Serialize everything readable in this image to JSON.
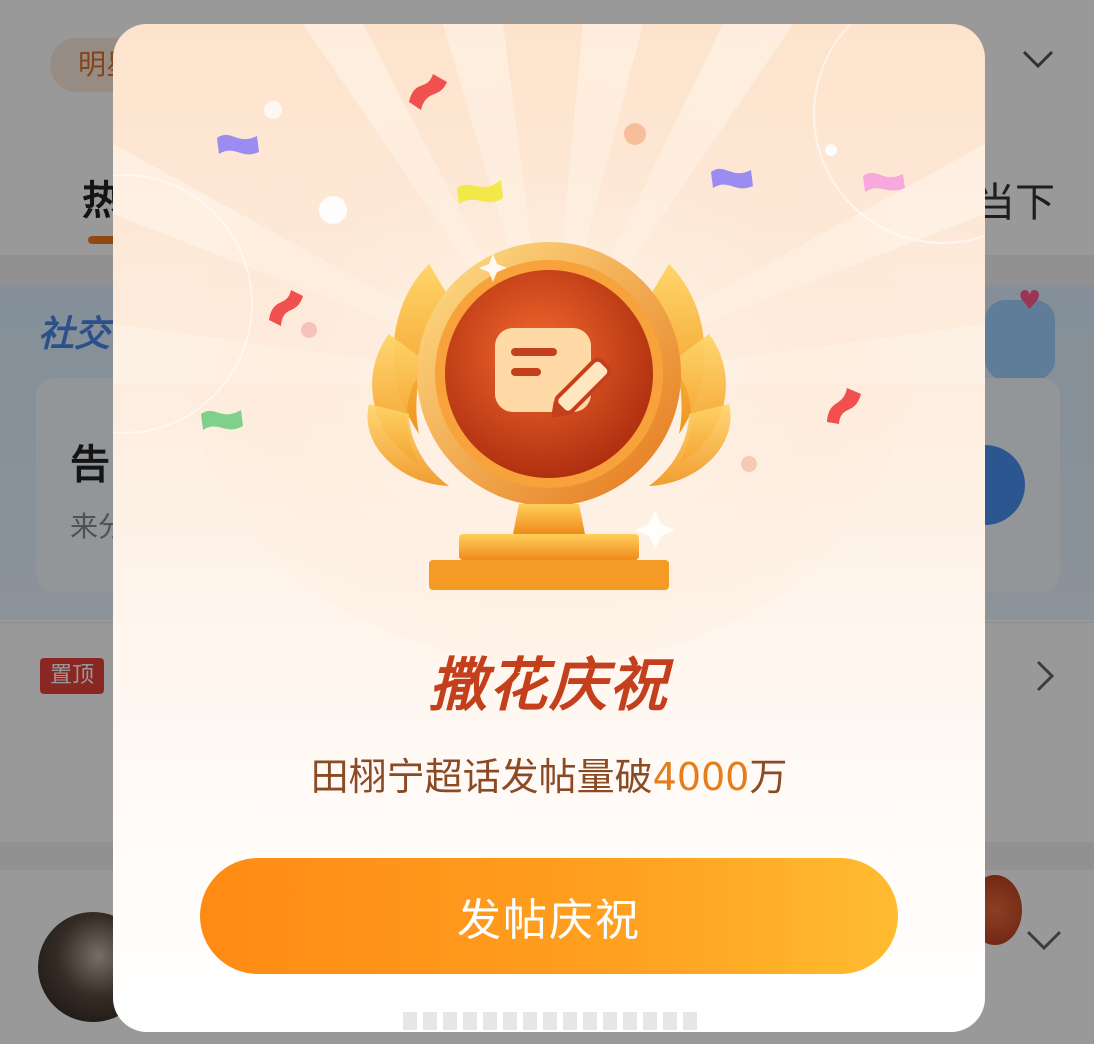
{
  "background": {
    "top_pill_label": "明星",
    "tabs": {
      "hot": "热门",
      "now": "当下"
    },
    "banner_title": "社交",
    "card_title": "告",
    "card_subtitle": "来分",
    "pin_badge": "置顶"
  },
  "modal": {
    "headline": "撒花庆祝",
    "subtitle_prefix": "田栩宁超话发帖量破",
    "subtitle_number": "4000",
    "subtitle_suffix": "万",
    "cta_label": "发帖庆祝",
    "trophy_icon": "note-edit-icon"
  },
  "colors": {
    "headline": "#c4401c",
    "accent": "#e47d1a",
    "cta_gradient_start": "#ff8a14",
    "cta_gradient_end": "#ffbc30",
    "overlay": "rgba(0,0,0,0.40)"
  }
}
